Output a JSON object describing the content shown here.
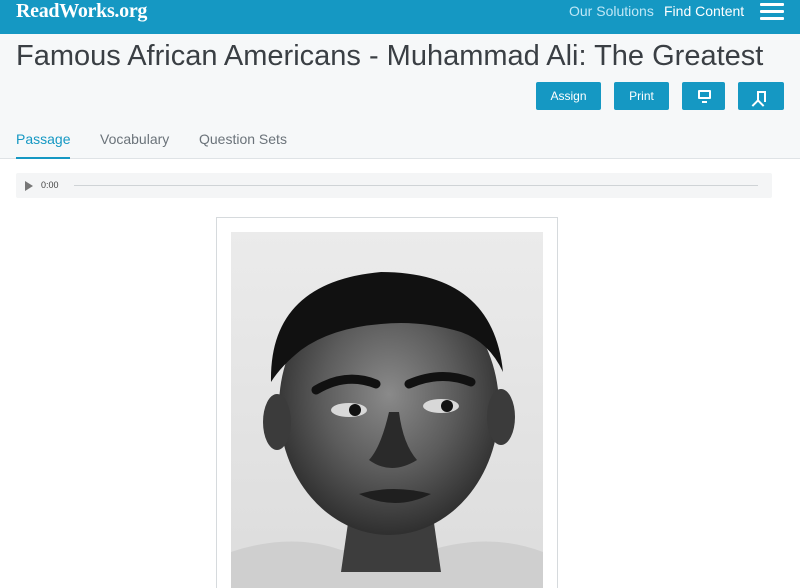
{
  "nav": {
    "logo": "ReadWorks.org",
    "our_solutions": "Our Solutions",
    "find_content": "Find Content"
  },
  "header": {
    "title": "Famous African Americans - Muhammad Ali: The Greatest",
    "assign_label": "Assign",
    "print_label": "Print"
  },
  "tabs": [
    {
      "label": "Passage",
      "active": true
    },
    {
      "label": "Vocabulary",
      "active": false
    },
    {
      "label": "Question Sets",
      "active": false
    }
  ],
  "player": {
    "time": "0:00",
    "progress": 0
  },
  "colors": {
    "brand": "#1598c3",
    "header_bg": "#f6f8f9"
  },
  "icons": [
    "hamburger-menu-icon",
    "monitor-icon",
    "bookmark-icon",
    "play-icon"
  ]
}
